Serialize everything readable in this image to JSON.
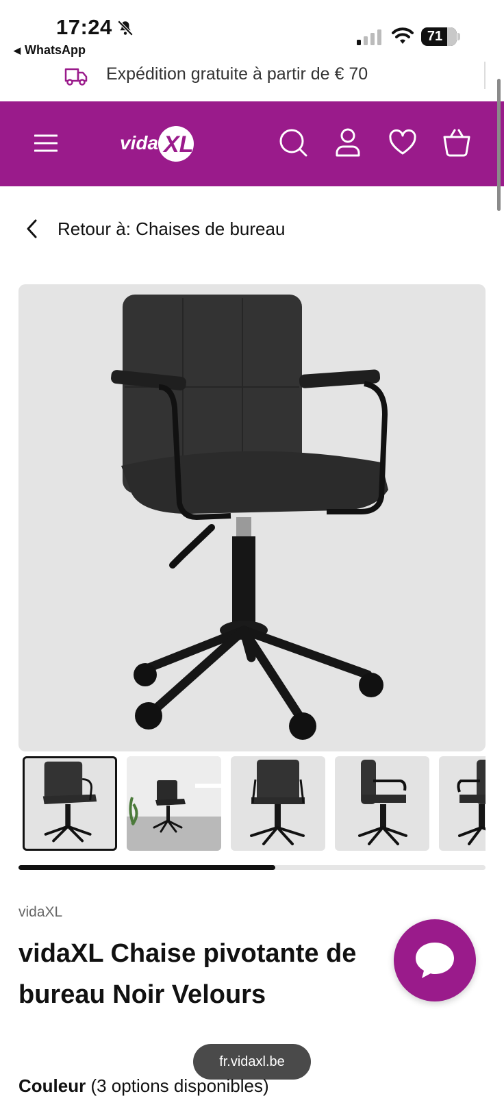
{
  "status_bar": {
    "time": "17:24",
    "back_app": "WhatsApp",
    "battery": "71"
  },
  "shipping_banner": {
    "text": "Expédition gratuite à partir de € 70"
  },
  "header": {
    "logo": "vidaXL",
    "bg_color": "#9a1b8b"
  },
  "breadcrumb": {
    "text": "Retour à: Chaises de bureau"
  },
  "gallery": {
    "progress_fraction": 0.55,
    "thumbnail_count": 5,
    "active_index": 0
  },
  "product": {
    "brand": "vidaXL",
    "title": "vidaXL Chaise pivotante de bureau Noir Velours",
    "color_label": "Couleur",
    "color_options": "(3 options disponibles)"
  },
  "browser": {
    "url": "fr.vidaxl.be"
  }
}
